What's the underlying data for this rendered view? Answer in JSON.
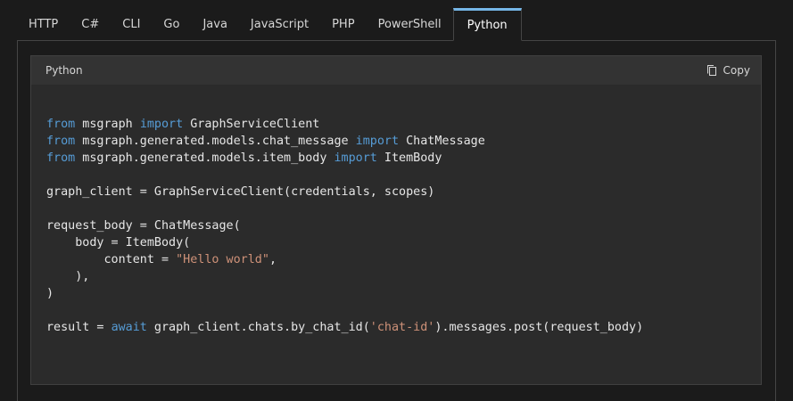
{
  "tabs": [
    {
      "label": "HTTP"
    },
    {
      "label": "C#"
    },
    {
      "label": "CLI"
    },
    {
      "label": "Go"
    },
    {
      "label": "Java"
    },
    {
      "label": "JavaScript"
    },
    {
      "label": "PHP"
    },
    {
      "label": "PowerShell"
    },
    {
      "label": "Python"
    }
  ],
  "active_tab": "Python",
  "code": {
    "language": "Python",
    "copy_label": "Copy",
    "copy_icon": "copy-icon",
    "colors": {
      "keyword": "#569cd6",
      "string": "#ce9178",
      "text": "#e6e6e6",
      "accent": "#75b6e7"
    },
    "lines": [
      [
        {
          "t": "from",
          "c": "kw"
        },
        {
          "t": " msgraph "
        },
        {
          "t": "import",
          "c": "kw"
        },
        {
          "t": " GraphServiceClient"
        }
      ],
      [
        {
          "t": "from",
          "c": "kw"
        },
        {
          "t": " msgraph.generated.models.chat_message "
        },
        {
          "t": "import",
          "c": "kw"
        },
        {
          "t": " ChatMessage"
        }
      ],
      [
        {
          "t": "from",
          "c": "kw"
        },
        {
          "t": " msgraph.generated.models.item_body "
        },
        {
          "t": "import",
          "c": "kw"
        },
        {
          "t": " ItemBody"
        }
      ],
      [],
      [
        {
          "t": "graph_client = GraphServiceClient(credentials, scopes)"
        }
      ],
      [],
      [
        {
          "t": "request_body = ChatMessage("
        }
      ],
      [
        {
          "t": "    body = ItemBody("
        }
      ],
      [
        {
          "t": "        content = "
        },
        {
          "t": "\"Hello world\"",
          "c": "str"
        },
        {
          "t": ","
        }
      ],
      [
        {
          "t": "    ),"
        }
      ],
      [
        {
          "t": ")"
        }
      ],
      [],
      [
        {
          "t": "result = "
        },
        {
          "t": "await",
          "c": "kw"
        },
        {
          "t": " graph_client.chats.by_chat_id("
        },
        {
          "t": "'chat-id'",
          "c": "str"
        },
        {
          "t": ").messages.post(request_body)"
        }
      ]
    ]
  }
}
